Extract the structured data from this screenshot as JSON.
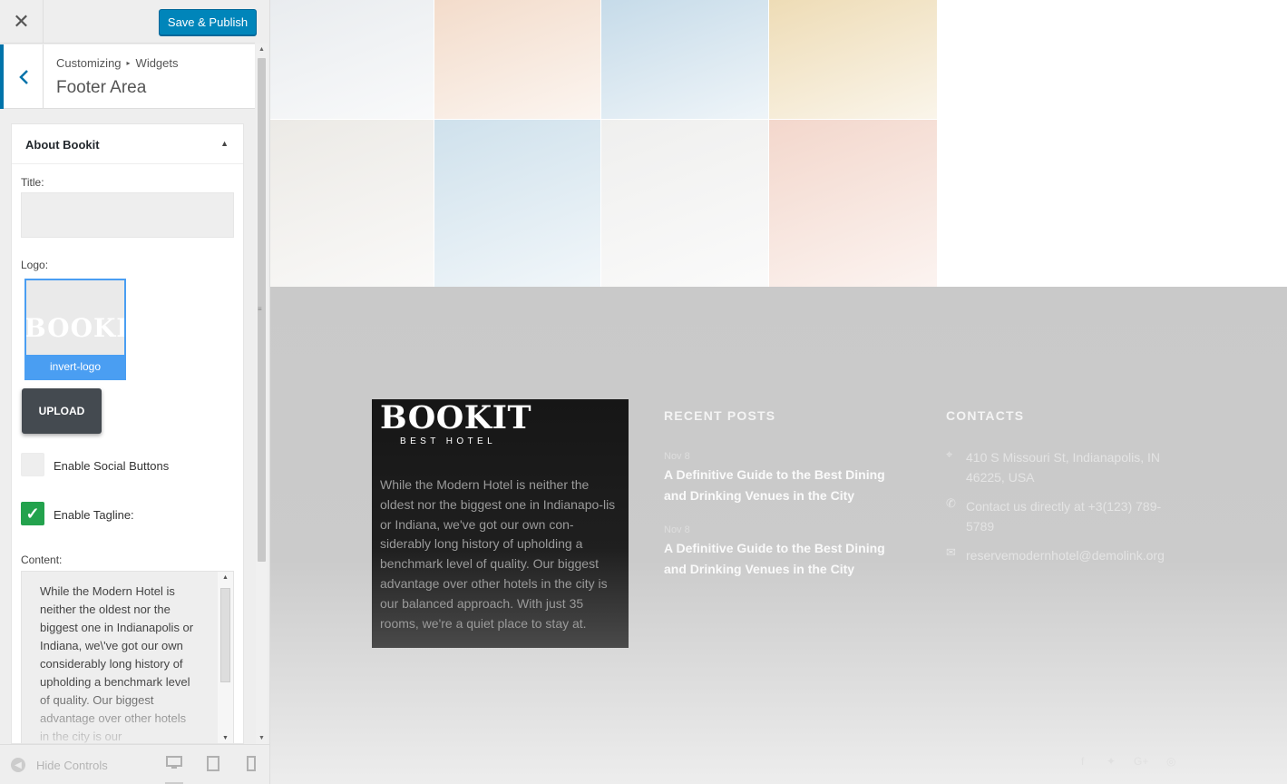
{
  "customizer": {
    "close_icon": "✕",
    "publish_label": "Save & Publish",
    "back_icon": "‹",
    "breadcrumb": {
      "parent": "Customizing",
      "separator": "▸",
      "current": "Widgets"
    },
    "section_title": "Footer Area",
    "widget": {
      "title": "About Bookit",
      "toggle_icon": "▲",
      "title_label": "Title:",
      "title_value": "",
      "logo_label": "Logo:",
      "logo_ghost_text": "BOOKIT",
      "logo_caption": "invert-logo",
      "upload_label": "UPLOAD",
      "social_label": "Enable Social Buttons",
      "social_checked": false,
      "tagline_label": "Enable Tagline:",
      "tagline_checked": true,
      "check_icon": "✓",
      "content_label": "Content:",
      "content_value": "While the Modern Hotel is neither the oldest nor the biggest one in Indianapolis or Indiana, we\\'ve got our own considerably long history of upholding a benchmark level of quality. Our biggest advantage over other hotels in the city is our"
    },
    "hide_controls_label": "Hide Controls",
    "devices": [
      "desktop-icon",
      "tablet-icon",
      "mobile-icon"
    ]
  },
  "preview": {
    "gallery_colors": [
      "#e9ecef",
      "#f3dccb",
      "#c6dbe9",
      "#eedcb6",
      "#eceae6",
      "#cfe1ec",
      "#efefee",
      "#f3d7cc"
    ],
    "about": {
      "brand": "BOOKIT",
      "tagline": "BEST HOTEL",
      "text": "While the Modern Hotel is neither the oldest nor the biggest one in Indianapo-lis or Indiana, we've got our own con-siderably long history of upholding a benchmark level of quality. Our biggest advantage over other hotels in the city is our balanced approach. With just 35 rooms, we're a quiet place to stay at."
    },
    "recent_posts": {
      "title": "RECENT POSTS",
      "posts": [
        {
          "date": "Nov 8",
          "title": "A Definitive Guide to the Best Dining and Drinking Venues in the City"
        },
        {
          "date": "Nov 8",
          "title": "A Definitive Guide to the Best Dining and Drinking Venues in the City"
        }
      ]
    },
    "contacts": {
      "title": "CONTACTS",
      "address": "410 S Missouri St, Indianapolis, IN 46225, USA",
      "phone": "Contact us directly at +3(123) 789-5789",
      "email": "reservemodernhotel@demolink.org"
    }
  }
}
